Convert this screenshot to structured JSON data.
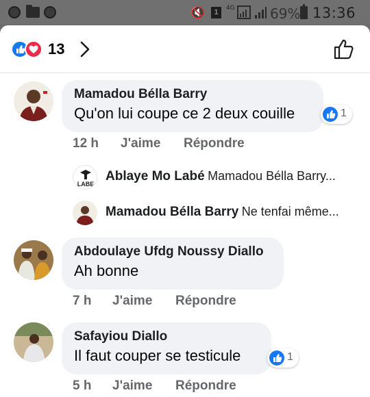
{
  "status_bar": {
    "network": "4G",
    "battery_percent": "69%",
    "time": "13:36"
  },
  "header": {
    "reaction_count": "13",
    "reaction_icons": [
      "like-icon",
      "love-icon"
    ],
    "like_icon": "thumbs-up-outline-icon"
  },
  "comments": [
    {
      "author": "Mamadou Bélla Barry",
      "text": "Qu'on lui coupe ce 2 deux couille",
      "time": "12 h",
      "like_label": "J'aime",
      "reply_label": "Répondre",
      "reaction_count": "1",
      "replies": [
        {
          "author": "Ablaye Mo Labé",
          "text": "Mamadou Bélla Barry...",
          "avatar_text": "LABE"
        },
        {
          "author": "Mamadou Bélla Barry",
          "text": "Ne tenfai même..."
        }
      ]
    },
    {
      "author": "Abdoulaye Ufdg Noussy Diallo",
      "text": "Ah bonne",
      "time": "7 h",
      "like_label": "J'aime",
      "reply_label": "Répondre"
    },
    {
      "author": "Safayiou Diallo",
      "text": "Il faut couper se testicule",
      "time": "5 h",
      "like_label": "J'aime",
      "reply_label": "Répondre",
      "reaction_count": "1"
    }
  ],
  "colors": {
    "accent": "#1877f2",
    "love": "#f0284a",
    "bubble": "#f0f2f5",
    "secondary_text": "#65676b"
  }
}
